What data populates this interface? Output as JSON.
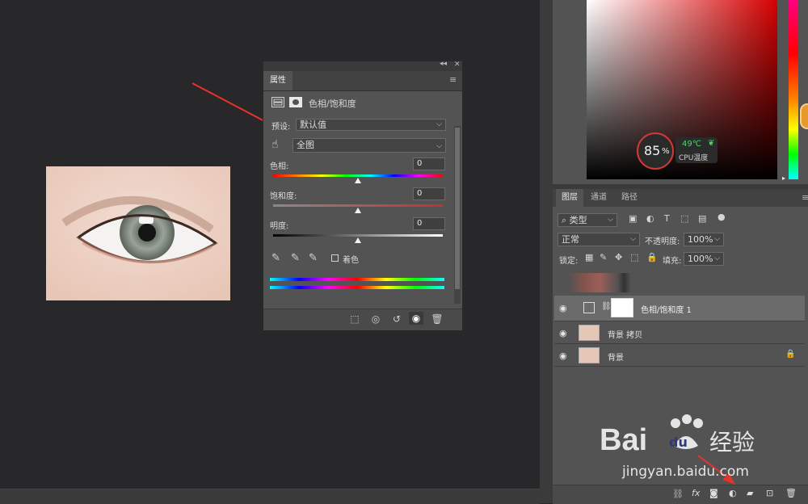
{
  "properties_panel": {
    "tab_label": "属性",
    "adjustment_title": "色相/饱和度",
    "preset_label": "预设:",
    "preset_value": "默认值",
    "channel_value": "全图",
    "hue_label": "色相:",
    "hue_value": "0",
    "saturation_label": "饱和度:",
    "saturation_value": "0",
    "lightness_label": "明度:",
    "lightness_value": "0",
    "colorize_label": "着色",
    "colorize_checked": false,
    "hue_slider_position": 0.5,
    "saturation_slider_position": 0.5,
    "lightness_slider_position": 0.5
  },
  "overlay": {
    "cpu_percent": "85",
    "percent_sign": "%",
    "temperature": "49℃",
    "temperature_label": "CPU温度"
  },
  "layers_panel": {
    "tabs": [
      "图层",
      "通道",
      "路径"
    ],
    "filter_type": "类型",
    "blend_mode": "正常",
    "opacity_label": "不透明度:",
    "opacity_value": "100%",
    "lock_label": "锁定:",
    "fill_label": "填充:",
    "fill_value": "100%",
    "layers": [
      {
        "name": "色相/饱和度 1",
        "selected": true
      },
      {
        "name": "背景 拷贝",
        "selected": false
      },
      {
        "name": "背景",
        "selected": false,
        "locked": true
      }
    ]
  },
  "watermark": {
    "brand": "Bai",
    "brand_suffix": "du",
    "brand_cn": "经验",
    "url": "jingyan.baidu.com"
  },
  "colors": {
    "annotation_arrow": "#e8322b",
    "accent_green": "#56d26a"
  }
}
